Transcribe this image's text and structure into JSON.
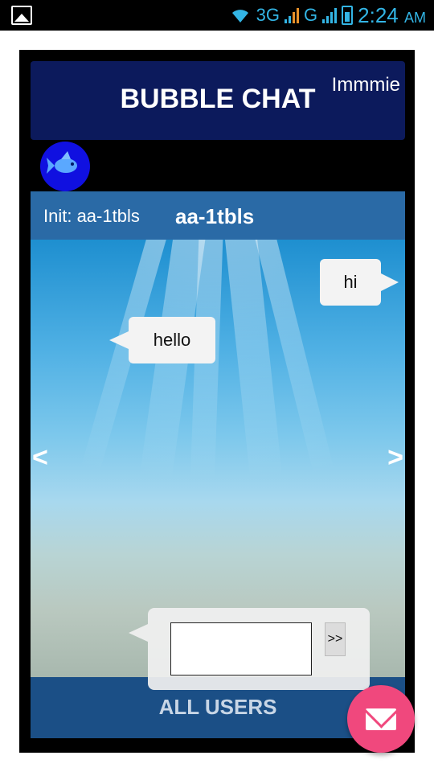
{
  "status_bar": {
    "network_1": "3G",
    "network_2": "G",
    "time": "2:24",
    "ampm": "AM"
  },
  "header": {
    "title": "BUBBLE CHAT",
    "username": "Immmie"
  },
  "chat": {
    "init_label": "Init: aa-1tbls",
    "room_name": "aa-1tbls",
    "messages": [
      {
        "text": "hi",
        "side": "right"
      },
      {
        "text": "hello",
        "side": "left"
      }
    ],
    "prev_label": "<",
    "next_label": ">",
    "send_label": ">>",
    "input_value": ""
  },
  "footer": {
    "all_users_label": "ALL USERS"
  },
  "colors": {
    "header_bg": "#0c1a5c",
    "topbar_bg": "#2a6aa6",
    "fab": "#f0487d",
    "status_accent": "#33b5e5"
  },
  "icons": {
    "status_image": "image-icon",
    "wifi": "wifi-icon",
    "signal": "signal-icon",
    "battery": "battery-charging-icon",
    "avatar": "fish-icon",
    "fab": "mail-icon"
  }
}
